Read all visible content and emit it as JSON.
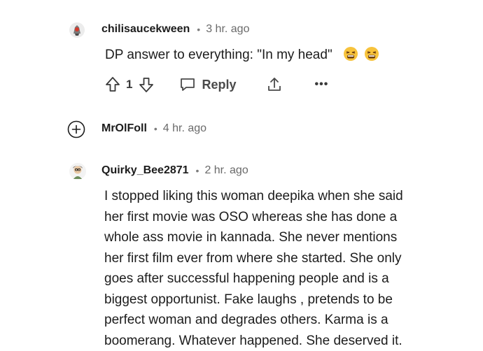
{
  "comments": [
    {
      "username": "chilisaucekween",
      "time": "3 hr. ago",
      "text": "DP answer to everything: \"In my head\"",
      "emojis": [
        "tired-face-emoji",
        "tired-face-emoji"
      ],
      "votes": "1",
      "reply_label": "Reply",
      "more_label": "•••"
    },
    {
      "username": "MrOlFoll",
      "time": "4 hr. ago"
    },
    {
      "username": "Quirky_Bee2871",
      "time": "2 hr. ago",
      "lines": [
        "I stopped liking this woman deepika when she said",
        "her first movie was OSO whereas she has done a",
        "whole ass movie in kannada. She never mentions",
        "her first film ever from where she started. She only",
        "goes after successful happening people and is a",
        "biggest opportunist. Fake laughs , pretends to be",
        "perfect woman and degrades others. Karma is a",
        "boomerang. Whatever happened. She deserved it."
      ]
    }
  ],
  "separator": "•",
  "colors": {
    "text": "#1c1c1c",
    "meta": "#6a6a6a",
    "icon": "#3a3a3a"
  }
}
